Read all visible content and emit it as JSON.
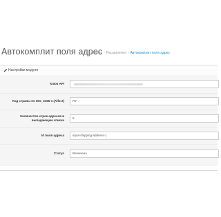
{
  "page": {
    "title": "Автокомплит поля адрес",
    "breadcrumb": [
      "Главная",
      "Расширения",
      "Автокомплит поля адрес"
    ]
  },
  "panel": {
    "heading": "Настройки модуля",
    "fields": [
      {
        "label": "Ключ API",
        "value": ""
      },
      {
        "label": "Код страны по ISO_3166-1 (Alfa-2)",
        "value": "RY"
      },
      {
        "label": "Количество строк адресов в выпадающем списке",
        "value": "5"
      },
      {
        "label": "Id поля адреса",
        "value": "input-shipping-address-1"
      },
      {
        "label": "Статус",
        "value": "Включено"
      }
    ]
  },
  "colors": {
    "accent": "#1e91cf",
    "panel_body": "#f5f5f5"
  },
  "icons": {
    "panel_heading": "pencil-icon"
  }
}
